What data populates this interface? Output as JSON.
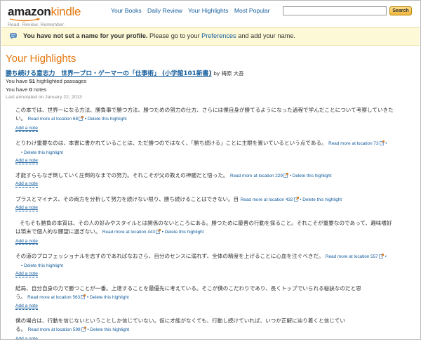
{
  "header": {
    "logo_main": "amazon",
    "logo_accent": "kindle",
    "tagline": "Read. Review. Remember.",
    "nav": [
      "Your Books",
      "Daily Review",
      "Your Highlights",
      "Most Popular"
    ],
    "search_value": "",
    "search_button": "Search"
  },
  "notice": {
    "bold": "You have not set a name for your profile.",
    "pre": " Please go to your ",
    "link": "Preferences",
    "post": " and add your name."
  },
  "page_title": "Your Highlights",
  "book": {
    "title": "勝ち続ける意志力　世界一プロ・ゲーマーの「仕事術」 (小学館101新書)",
    "author": "( by 梅原 大吾",
    "passages_pre": "You have ",
    "passages_count": "51",
    "passages_post": " highlighted passages",
    "notes_pre": "You have ",
    "notes_count": "0",
    "notes_post": " notes",
    "last_annotated": "Last annotated on January 22, 2013"
  },
  "labels": {
    "read_more": "Read more at location",
    "delete": "Delete this highlight",
    "add_note": "Add a note",
    "sep": "•"
  },
  "highlights": [
    {
      "lines": [
        "この本では、世界一になる方法、勝負事で勝つ方法、勝つための努力の仕方、さらには僕自身が勝てるようになった過程で学んだことについて考察していきた",
        "い。"
      ],
      "location": "68"
    },
    {
      "lines": [
        "とりわけ重要なのは、本書に書かれていることは、ただ勝つのではなく、「勝ち続ける」ことに主眼を置いているという点である。"
      ],
      "location": "73"
    },
    {
      "lines": [
        "才能すらもなぎ倒していく圧倒的なまでの努力。それこそが父の教えの神髄だと悟った。"
      ],
      "location": "229"
    },
    {
      "lines": [
        "プラスとマイナス、その両方を分析して努力を続けない限り、勝ち続けることはできない。自"
      ],
      "location": "432"
    },
    {
      "lines": [
        "そもそも勝負の本質は、その人の好みやスタイルとは関係のないところにある。勝つために最善の行動を採ること。それこそが重要なのであって、趣味嗜好",
        "は瑣末で個人的な願望に過ぎない。"
      ],
      "location": "443"
    },
    {
      "lines": [
        "その道のプロフェッショナルを志すのであればなおさら、自分のセンスに溺れず、全体の精度を上げることに心血を注ぐべきだ。"
      ],
      "location": "557"
    },
    {
      "lines": [
        "結局、自分自身の力で勝つことが一番。上達することを最優先に考えている。そこが僕のこだわりであり、長くトップでいられる秘訣なのだと思",
        "う。"
      ],
      "location": "563"
    },
    {
      "lines": [
        "僕の場合は、行動を信じないということしか信じていない。仮に才能がなくても、行動し続けていれば、いつか正解に辿り着くと信じてい",
        "る。"
      ],
      "location": "599"
    }
  ]
}
